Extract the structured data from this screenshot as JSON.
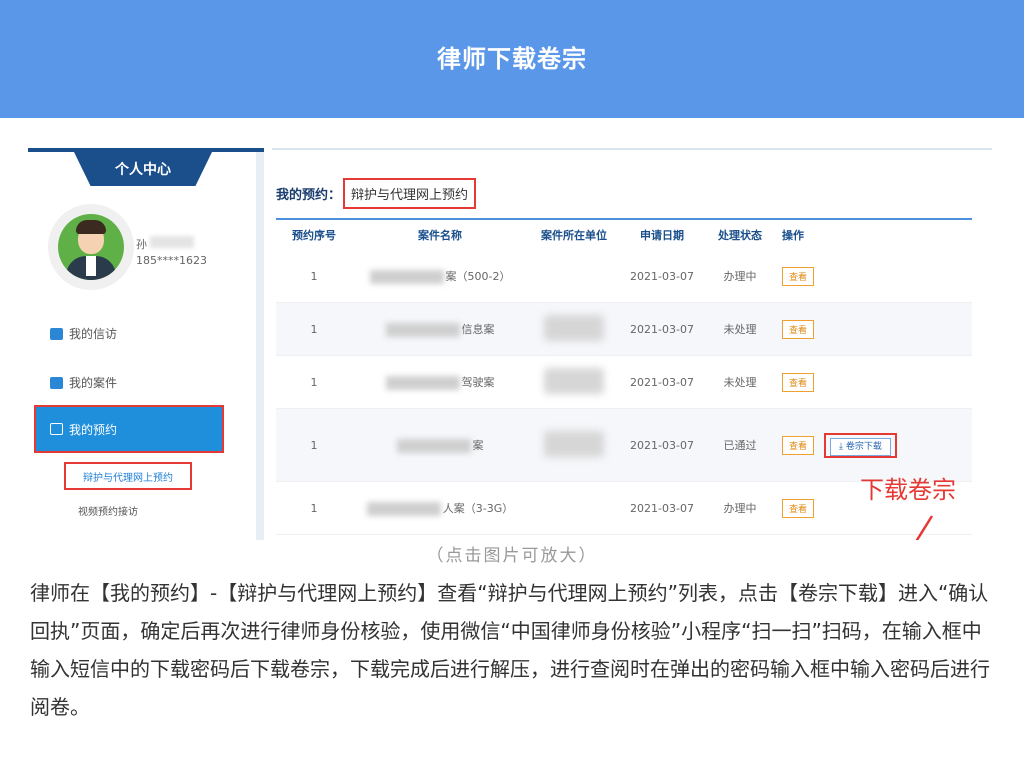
{
  "header": {
    "title": "律师下载卷宗"
  },
  "sidebar": {
    "banner": "个人中心",
    "user": {
      "name": "孙",
      "phone": "185****1623"
    },
    "items": [
      {
        "label": "我的信访"
      },
      {
        "label": "我的案件"
      },
      {
        "label": "我的预约"
      }
    ],
    "sub_items": [
      {
        "label": "辩护与代理网上预约"
      },
      {
        "label": "视频预约接访"
      }
    ]
  },
  "main": {
    "crumb_label": "我的预约：",
    "crumb_link": "辩护与代理网上预约",
    "columns": [
      "预约序号",
      "案件名称",
      "案件所在单位",
      "申请日期",
      "处理状态",
      "操作"
    ],
    "rows": [
      {
        "no": "1",
        "name_suffix": "案（500-2）",
        "date": "2021-03-07",
        "status": "办理中",
        "view": "查看"
      },
      {
        "no": "1",
        "name_suffix": "信息案",
        "date": "2021-03-07",
        "status": "未处理",
        "view": "查看"
      },
      {
        "no": "1",
        "name_suffix": "驾驶案",
        "date": "2021-03-07",
        "status": "未处理",
        "view": "查看"
      },
      {
        "no": "1",
        "name_suffix": "案",
        "date": "2021-03-07",
        "status": "已通过",
        "view": "查看",
        "download": "卷宗下载"
      },
      {
        "no": "1",
        "name_suffix": "人案（3-3G）",
        "date": "2021-03-07",
        "status": "办理中",
        "view": "查看"
      }
    ]
  },
  "annotation": {
    "label": "下载卷宗"
  },
  "caption": "（点击图片可放大）",
  "description": "律师在【我的预约】-【辩护与代理网上预约】查看“辩护与代理网上预约”列表，点击【卷宗下载】进入“确认回执”页面，确定后再次进行律师身份核验，使用微信“中国律师身份核验”小程序“扫一扫”扫码，在输入框中输入短信中的下载密码后下载卷宗，下载完成后进行解压，进行查阅时在弹出的密码输入框中输入密码后进行阅卷。",
  "colors": {
    "header": "#5b97e8",
    "accent_red": "#e53935",
    "nav_active": "#1f8fdc",
    "dark_blue": "#1a4f8c"
  }
}
